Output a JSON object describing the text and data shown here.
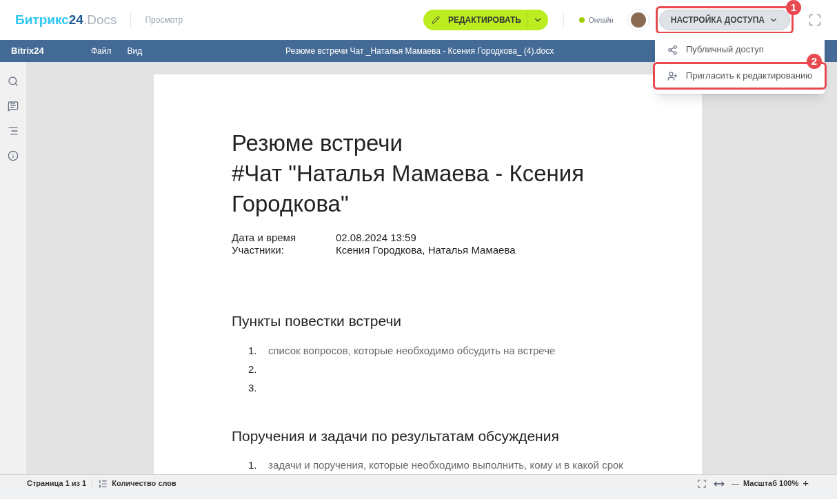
{
  "header": {
    "logo_brand": "Битрикс",
    "logo_number": "24",
    "logo_suffix": ".Docs",
    "mode": "Просмотр",
    "edit_button": "РЕДАКТИРОВАТЬ",
    "status": "Онлайн",
    "access_button": "НАСТРОЙКА ДОСТУПА"
  },
  "annotations": [
    {
      "label": "1"
    },
    {
      "label": "2"
    }
  ],
  "access_menu": [
    {
      "kind": "share",
      "label": "Публичный доступ",
      "highlighted": false
    },
    {
      "kind": "invite",
      "label": "Пригласить к редактированию",
      "highlighted": true
    }
  ],
  "editor_bar": {
    "logo": "Bitrix24",
    "menus": [
      "Файл",
      "Вид"
    ],
    "file_name": "Резюме встречи Чат _Наталья Мамаева - Ксения Городкова_ (4).docx"
  },
  "document": {
    "title_lines": [
      "Резюме встречи",
      "#Чат \"Наталья Мамаева - Ксения",
      "Городкова\""
    ],
    "meta": [
      {
        "label": "Дата и время",
        "value": "02.08.2024 13:59"
      },
      {
        "label": "Участники:",
        "value": "Ксения Городкова, Наталья Мамаева"
      }
    ],
    "sections": [
      {
        "heading": "Пункты повестки встречи",
        "items": [
          {
            "number": "1.",
            "text": "список вопросов, которые необходимо обсудить на встрече"
          },
          {
            "number": "2."
          },
          {
            "number": "3."
          }
        ]
      },
      {
        "heading": "Поручения и задачи по результатам обсуждения",
        "items": [
          {
            "number": "1.",
            "text": "задачи и поручения, которые необходимо выполнить, кому и в какой срок"
          }
        ]
      }
    ]
  },
  "status_bar": {
    "page": "Страница 1 из 1",
    "word_count": "Количество слов",
    "zoom": "Масштаб 100%",
    "zoom_out": "—",
    "zoom_in": "+"
  }
}
